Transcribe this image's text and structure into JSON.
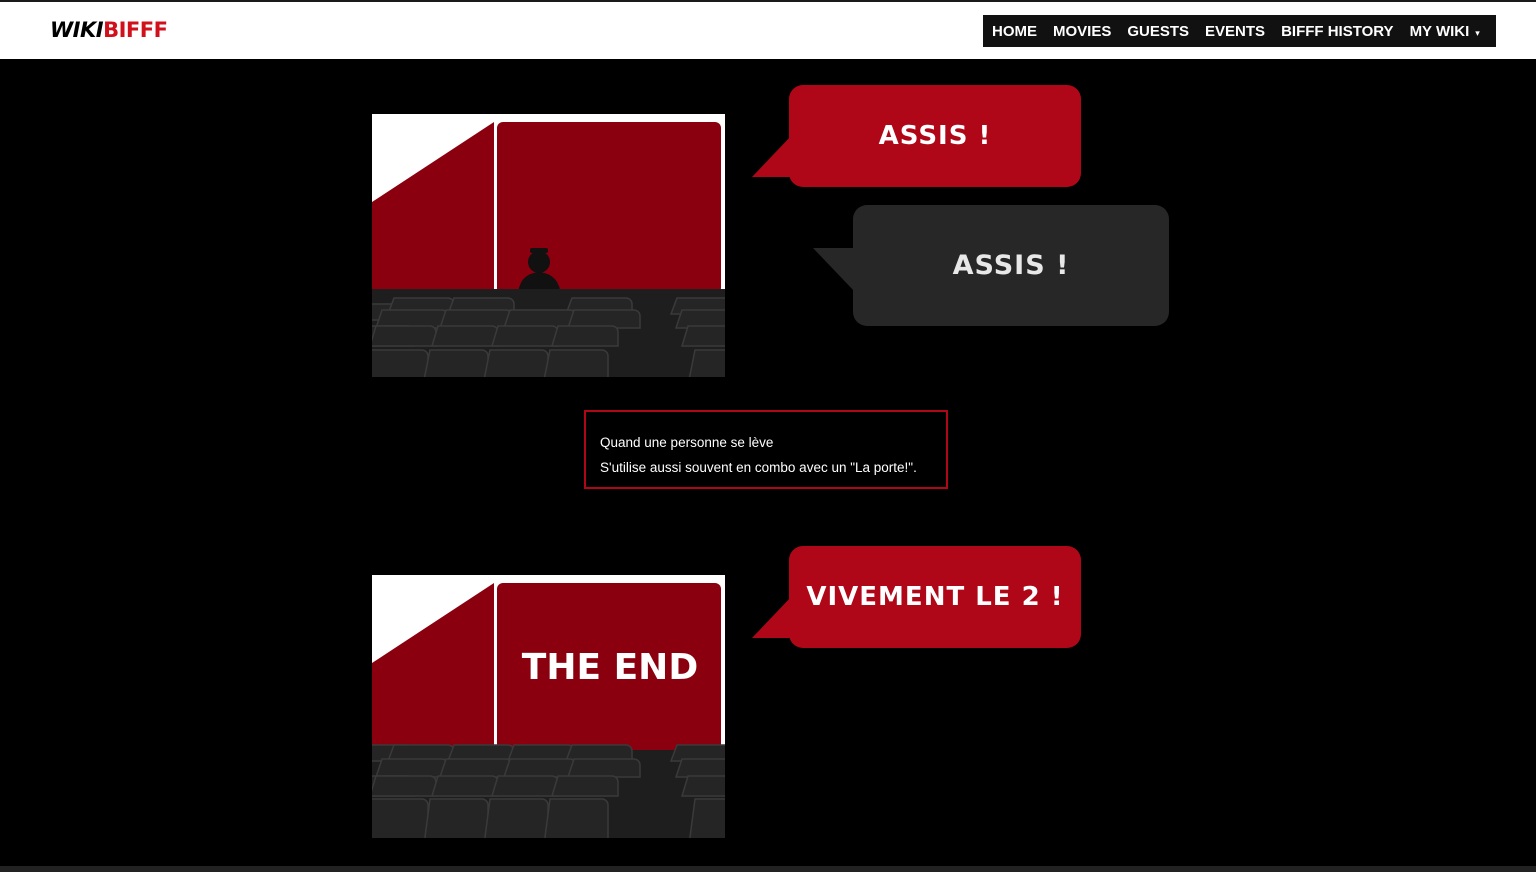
{
  "logo": {
    "part1": "WIKI",
    "part2": "BIFFF"
  },
  "nav": {
    "items": [
      "HOME",
      "MOVIES",
      "GUESTS",
      "EVENTS",
      "BIFFF HISTORY",
      "MY WIKI"
    ],
    "caret": "▾"
  },
  "scene1": {
    "bubble_red": "ASSIS !",
    "bubble_dark": "ASSIS !"
  },
  "caption": {
    "line1": "Quand une personne se lève",
    "line2": "S'utilise aussi souvent en combo avec un \"La porte!\"."
  },
  "scene2": {
    "screen_text": "THE END",
    "bubble_red": "VIVEMENT LE 2 !"
  },
  "colors": {
    "accent": "#b00718",
    "screen": "#8b000e",
    "seat": "#222222"
  }
}
